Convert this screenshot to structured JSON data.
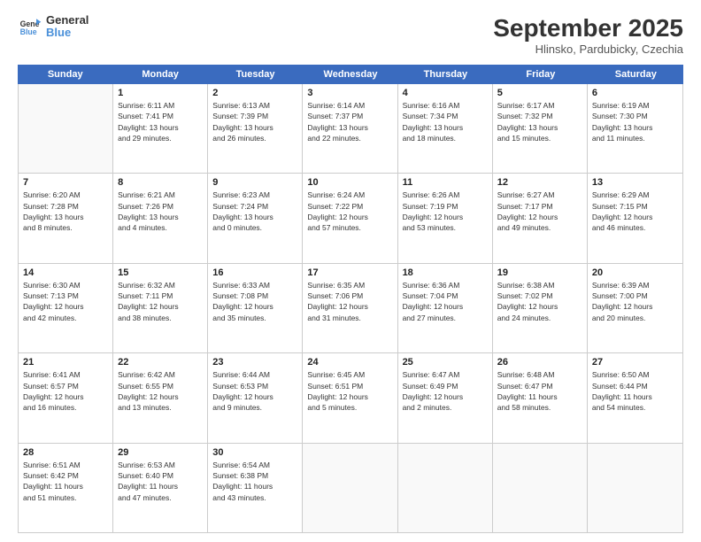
{
  "logo": {
    "line1": "General",
    "line2": "Blue"
  },
  "title": "September 2025",
  "subtitle": "Hlinsko, Pardubicky, Czechia",
  "header_days": [
    "Sunday",
    "Monday",
    "Tuesday",
    "Wednesday",
    "Thursday",
    "Friday",
    "Saturday"
  ],
  "weeks": [
    [
      {
        "day": "",
        "info": ""
      },
      {
        "day": "1",
        "info": "Sunrise: 6:11 AM\nSunset: 7:41 PM\nDaylight: 13 hours\nand 29 minutes."
      },
      {
        "day": "2",
        "info": "Sunrise: 6:13 AM\nSunset: 7:39 PM\nDaylight: 13 hours\nand 26 minutes."
      },
      {
        "day": "3",
        "info": "Sunrise: 6:14 AM\nSunset: 7:37 PM\nDaylight: 13 hours\nand 22 minutes."
      },
      {
        "day": "4",
        "info": "Sunrise: 6:16 AM\nSunset: 7:34 PM\nDaylight: 13 hours\nand 18 minutes."
      },
      {
        "day": "5",
        "info": "Sunrise: 6:17 AM\nSunset: 7:32 PM\nDaylight: 13 hours\nand 15 minutes."
      },
      {
        "day": "6",
        "info": "Sunrise: 6:19 AM\nSunset: 7:30 PM\nDaylight: 13 hours\nand 11 minutes."
      }
    ],
    [
      {
        "day": "7",
        "info": "Sunrise: 6:20 AM\nSunset: 7:28 PM\nDaylight: 13 hours\nand 8 minutes."
      },
      {
        "day": "8",
        "info": "Sunrise: 6:21 AM\nSunset: 7:26 PM\nDaylight: 13 hours\nand 4 minutes."
      },
      {
        "day": "9",
        "info": "Sunrise: 6:23 AM\nSunset: 7:24 PM\nDaylight: 13 hours\nand 0 minutes."
      },
      {
        "day": "10",
        "info": "Sunrise: 6:24 AM\nSunset: 7:22 PM\nDaylight: 12 hours\nand 57 minutes."
      },
      {
        "day": "11",
        "info": "Sunrise: 6:26 AM\nSunset: 7:19 PM\nDaylight: 12 hours\nand 53 minutes."
      },
      {
        "day": "12",
        "info": "Sunrise: 6:27 AM\nSunset: 7:17 PM\nDaylight: 12 hours\nand 49 minutes."
      },
      {
        "day": "13",
        "info": "Sunrise: 6:29 AM\nSunset: 7:15 PM\nDaylight: 12 hours\nand 46 minutes."
      }
    ],
    [
      {
        "day": "14",
        "info": "Sunrise: 6:30 AM\nSunset: 7:13 PM\nDaylight: 12 hours\nand 42 minutes."
      },
      {
        "day": "15",
        "info": "Sunrise: 6:32 AM\nSunset: 7:11 PM\nDaylight: 12 hours\nand 38 minutes."
      },
      {
        "day": "16",
        "info": "Sunrise: 6:33 AM\nSunset: 7:08 PM\nDaylight: 12 hours\nand 35 minutes."
      },
      {
        "day": "17",
        "info": "Sunrise: 6:35 AM\nSunset: 7:06 PM\nDaylight: 12 hours\nand 31 minutes."
      },
      {
        "day": "18",
        "info": "Sunrise: 6:36 AM\nSunset: 7:04 PM\nDaylight: 12 hours\nand 27 minutes."
      },
      {
        "day": "19",
        "info": "Sunrise: 6:38 AM\nSunset: 7:02 PM\nDaylight: 12 hours\nand 24 minutes."
      },
      {
        "day": "20",
        "info": "Sunrise: 6:39 AM\nSunset: 7:00 PM\nDaylight: 12 hours\nand 20 minutes."
      }
    ],
    [
      {
        "day": "21",
        "info": "Sunrise: 6:41 AM\nSunset: 6:57 PM\nDaylight: 12 hours\nand 16 minutes."
      },
      {
        "day": "22",
        "info": "Sunrise: 6:42 AM\nSunset: 6:55 PM\nDaylight: 12 hours\nand 13 minutes."
      },
      {
        "day": "23",
        "info": "Sunrise: 6:44 AM\nSunset: 6:53 PM\nDaylight: 12 hours\nand 9 minutes."
      },
      {
        "day": "24",
        "info": "Sunrise: 6:45 AM\nSunset: 6:51 PM\nDaylight: 12 hours\nand 5 minutes."
      },
      {
        "day": "25",
        "info": "Sunrise: 6:47 AM\nSunset: 6:49 PM\nDaylight: 12 hours\nand 2 minutes."
      },
      {
        "day": "26",
        "info": "Sunrise: 6:48 AM\nSunset: 6:47 PM\nDaylight: 11 hours\nand 58 minutes."
      },
      {
        "day": "27",
        "info": "Sunrise: 6:50 AM\nSunset: 6:44 PM\nDaylight: 11 hours\nand 54 minutes."
      }
    ],
    [
      {
        "day": "28",
        "info": "Sunrise: 6:51 AM\nSunset: 6:42 PM\nDaylight: 11 hours\nand 51 minutes."
      },
      {
        "day": "29",
        "info": "Sunrise: 6:53 AM\nSunset: 6:40 PM\nDaylight: 11 hours\nand 47 minutes."
      },
      {
        "day": "30",
        "info": "Sunrise: 6:54 AM\nSunset: 6:38 PM\nDaylight: 11 hours\nand 43 minutes."
      },
      {
        "day": "",
        "info": ""
      },
      {
        "day": "",
        "info": ""
      },
      {
        "day": "",
        "info": ""
      },
      {
        "day": "",
        "info": ""
      }
    ]
  ]
}
